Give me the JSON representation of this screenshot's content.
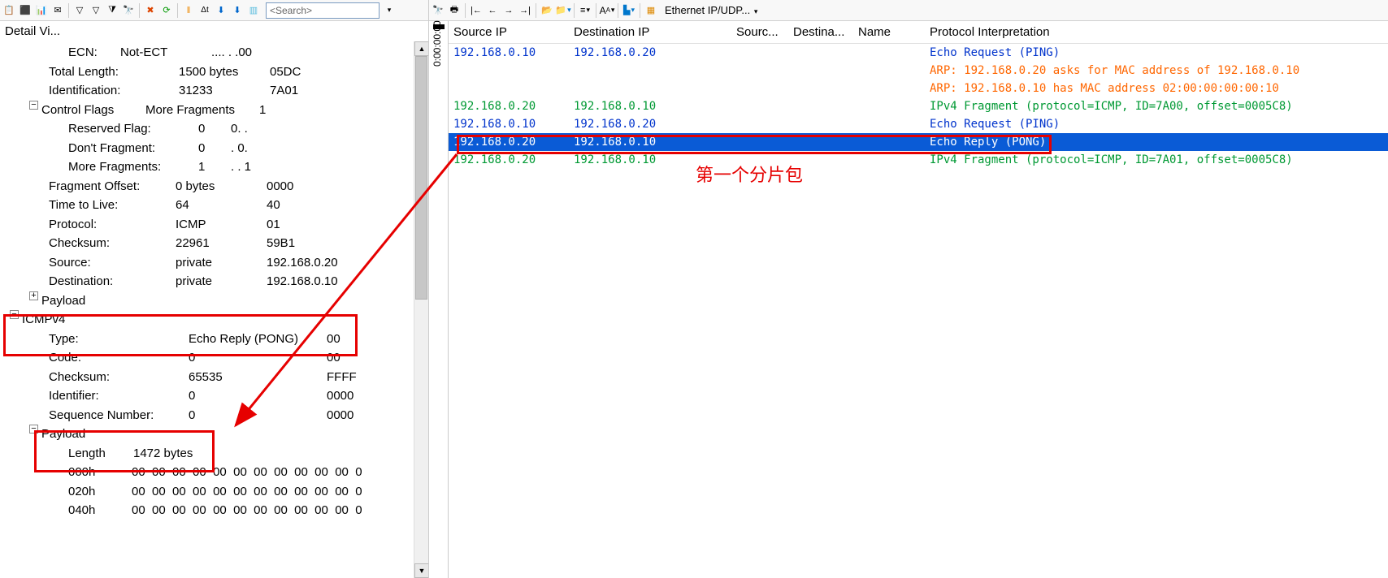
{
  "search_placeholder": "<Search>",
  "detail_header": "Detail Vi...",
  "ethernet_label": "Ethernet IP/UDP...",
  "annotation_text": "第一个分片包",
  "tree": {
    "ecn": {
      "k": "ECN:",
      "v": "Not-ECT",
      "h": ".... . .00"
    },
    "totlen": {
      "k": "Total Length:",
      "v": "1500 bytes",
      "h": "05DC"
    },
    "ident": {
      "k": "Identification:",
      "v": "31233",
      "h": "7A01"
    },
    "ctlflags": {
      "k": "Control Flags",
      "v": "More Fragments",
      "h": "1"
    },
    "resflag": {
      "k": "Reserved Flag:",
      "v": "0",
      "h": "0. ."
    },
    "dontfrag": {
      "k": "Don't Fragment:",
      "v": "0",
      "h": ". 0."
    },
    "morefrag": {
      "k": "More Fragments:",
      "v": "1",
      "h": ". . 1"
    },
    "fragoff": {
      "k": "Fragment Offset:",
      "v": "0 bytes",
      "h": "0000"
    },
    "ttl": {
      "k": "Time to Live:",
      "v": "64",
      "h": "40"
    },
    "proto": {
      "k": "Protocol:",
      "v": "ICMP",
      "h": "01"
    },
    "chksum": {
      "k": "Checksum:",
      "v": "22961",
      "h": "59B1"
    },
    "src": {
      "k": "Source:",
      "v": "private",
      "h": "192.168.0.20"
    },
    "dst": {
      "k": "Destination:",
      "v": "private",
      "h": "192.168.0.10"
    },
    "payload1": {
      "k": "Payload"
    },
    "icmpv4": {
      "k": "ICMPv4"
    },
    "type": {
      "k": "Type:",
      "v": "Echo Reply (PONG)",
      "h": "00"
    },
    "code": {
      "k": "Code:",
      "v": "0",
      "h": "00"
    },
    "chk2": {
      "k": "Checksum:",
      "v": "65535",
      "h": "FFFF"
    },
    "idfr": {
      "k": "Identifier:",
      "v": "0",
      "h": "0000"
    },
    "seqn": {
      "k": "Sequence Number:",
      "v": "0",
      "h": "0000"
    },
    "payload2": {
      "k": "Payload"
    },
    "plen": {
      "k": "Length",
      "v": "1472 bytes"
    },
    "h000": {
      "k": "000h",
      "v": "00  00  00  00  00  00  00  00  00  00  00  0"
    },
    "h020": {
      "k": "020h",
      "v": "00  00  00  00  00  00  00  00  00  00  00  0"
    },
    "h040": {
      "k": "040h",
      "v": "00  00  00  00  00  00  00  00  00  00  00  0"
    }
  },
  "grid": {
    "head": {
      "src": "Source IP",
      "dst": "Destination IP",
      "sp": "Sourc...",
      "dp": "Destina...",
      "nm": "Name",
      "pi": "Protocol Interpretation"
    },
    "rows": [
      {
        "src": "192.168.0.10",
        "dst": "192.168.0.20",
        "pi": "Echo Request (PING)",
        "cls": "clr-blue"
      },
      {
        "src": "",
        "dst": "",
        "pi": "ARP: 192.168.0.20 asks for MAC address of 192.168.0.10",
        "cls": "clr-orange"
      },
      {
        "src": "",
        "dst": "",
        "pi": "ARP: 192.168.0.10 has MAC address 02:00:00:00:00:10",
        "cls": "clr-orange"
      },
      {
        "src": "192.168.0.20",
        "dst": "192.168.0.10",
        "pi": "IPv4 Fragment (protocol=ICMP, ID=7A00, offset=0005C8)",
        "cls": "clr-green"
      },
      {
        "src": "192.168.0.10",
        "dst": "192.168.0.20",
        "pi": "Echo Request (PING)",
        "cls": "clr-blue"
      },
      {
        "src": "192.168.0.20",
        "dst": "192.168.0.10",
        "pi": "Echo Reply (PONG)",
        "cls": "row-sel"
      },
      {
        "src": "192.168.0.20",
        "dst": "192.168.0.10",
        "pi": "IPv4 Fragment (protocol=ICMP, ID=7A01, offset=0005C8)",
        "cls": "clr-green"
      }
    ]
  },
  "time_label": "0:00:00:00"
}
